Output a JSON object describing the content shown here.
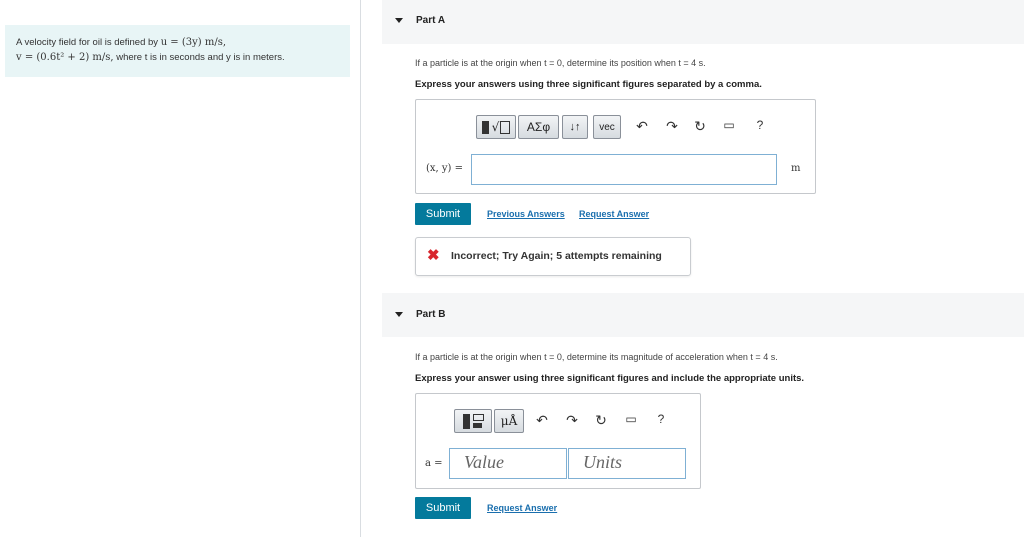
{
  "problem": {
    "line1_text": "A velocity field for oil is defined by ",
    "line1_math": "u = (3y) m/s,",
    "line2_math": "v = (0.6t² + 2) m/s,",
    "line2_text": " where t is in seconds and y is in meters."
  },
  "partA": {
    "title": "Part A",
    "question": "If a particle is at the origin when t = 0, determine its position when t = 4 s.",
    "instruction": "Express your answers using three significant figures separated by a comma.",
    "toolbar": {
      "sqrt_label": "√",
      "greek_label": "ΑΣφ",
      "arrows_label": "↓↑",
      "vec_label": "vec",
      "undo_icon": "undo-icon",
      "redo_icon": "redo-icon",
      "reset_icon": "reset-icon",
      "keyboard_icon": "keyboard-icon",
      "help_label": "?"
    },
    "input_label": "(x, y) =",
    "input_value": "",
    "unit": "m",
    "submit_label": "Submit",
    "previous_answers_label": "Previous Answers",
    "request_answer_label": "Request Answer",
    "feedback": "Incorrect; Try Again; 5 attempts remaining"
  },
  "partB": {
    "title": "Part B",
    "question": "If a particle is at the origin when t = 0, determine its magnitude of acceleration when t = 4 s.",
    "instruction": "Express your answer using three significant figures and include the appropriate units.",
    "toolbar": {
      "units_label": "μÅ",
      "help_label": "?"
    },
    "input_label": "a =",
    "value_placeholder": "Value",
    "units_placeholder": "Units",
    "submit_label": "Submit",
    "request_answer_label": "Request Answer"
  },
  "colors": {
    "submit_bg": "#047a9c",
    "link": "#1a6fae",
    "incorrect": "#d8262d",
    "problem_bg": "#e8f5f6"
  }
}
